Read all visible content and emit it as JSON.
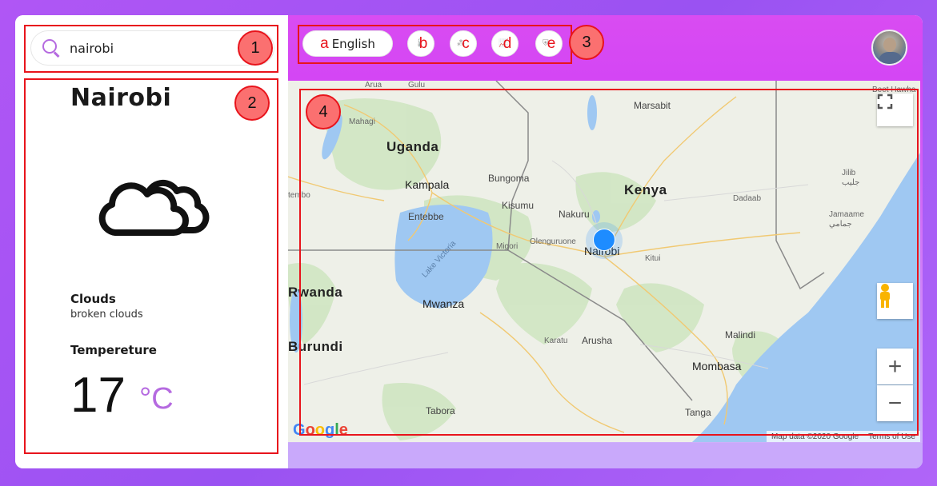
{
  "search": {
    "value": "nairobi",
    "placeholder": ""
  },
  "weather": {
    "city": "Nairobi",
    "condition_title": "Clouds",
    "condition_desc": "broken clouds",
    "temperature_title": "Tempereture",
    "temperature_value": "17",
    "temperature_unit": "°C"
  },
  "toolbar": {
    "language_letter": "a",
    "language_label": "English",
    "buttons": [
      {
        "letter": "b",
        "icon": "temperature-icon"
      },
      {
        "letter": "c",
        "icon": "hierarchy-icon"
      },
      {
        "letter": "d",
        "icon": "chart-icon"
      },
      {
        "letter": "e",
        "icon": "shield-icon"
      }
    ]
  },
  "annotations": [
    "1",
    "2",
    "3",
    "4"
  ],
  "map": {
    "countries": [
      "Uganda",
      "Kenya",
      "Rwanda",
      "Burundi"
    ],
    "cities_major": [
      "Kampala",
      "Nairobi",
      "Mwanza",
      "Mombasa"
    ],
    "cities": [
      "Arua",
      "Gulu",
      "Mahagi",
      "Bungoma",
      "Kisumu",
      "Nakuru",
      "Entebbe",
      "Olenguruone",
      "Migori",
      "Kitui",
      "Marsabit",
      "Dadaab",
      "Jamaame",
      "Jilib",
      "Malindi",
      "Arusha",
      "Karatu",
      "Tabora",
      "Tanga",
      "tembo"
    ],
    "arabic_labels": [
      "جليب",
      "جمامي"
    ],
    "lake_label": "Lake Victoria",
    "attribution": "Map data ©2020 Google",
    "terms": "Terms of Use",
    "google": [
      "G",
      "o",
      "o",
      "g",
      "l",
      "e"
    ],
    "top_right_label": "Beet Hawha"
  },
  "colors": {
    "accent": "#b56ae0",
    "annotation_red": "#e8141c",
    "annotation_fill": "#fb7070",
    "water": "#9fc8f2",
    "pin": "#1e8cff"
  }
}
